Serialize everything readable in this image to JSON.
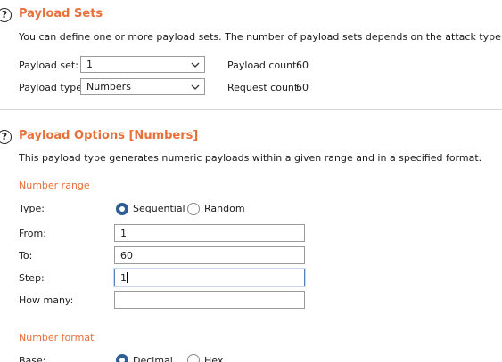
{
  "payload_sets": {
    "title": "Payload Sets",
    "description": "You can define one or more payload sets. The number of payload sets depends on the attack type defined in the Po",
    "payload_set_label": "Payload set:",
    "payload_set_value": "1",
    "payload_type_label": "Payload type:",
    "payload_type_value": "Numbers",
    "payload_count_label": "Payload count:",
    "payload_count_value": "60",
    "request_count_label": "Request count:",
    "request_count_value": "60"
  },
  "payload_options": {
    "title": "Payload Options [Numbers]",
    "description": "This payload type generates numeric payloads within a given range and in a specified format.",
    "number_range": {
      "heading": "Number range",
      "type_label": "Type:",
      "sequential_label": "Sequential",
      "random_label": "Random",
      "from_label": "From:",
      "from_value": "1",
      "to_label": "To:",
      "to_value": "60",
      "step_label": "Step:",
      "step_value": "1",
      "how_many_label": "How many:",
      "how_many_value": ""
    },
    "number_format": {
      "heading": "Number format",
      "base_label": "Base:",
      "decimal_label": "Decimal",
      "hex_label": "Hex"
    }
  },
  "help_glyph": "?",
  "icons": [
    "help-icon",
    "chevron-down-icon"
  ],
  "colors": {
    "accent": "#e8703a",
    "radio_selected": "#2e5d96",
    "focus_border": "#5b7fb7"
  }
}
